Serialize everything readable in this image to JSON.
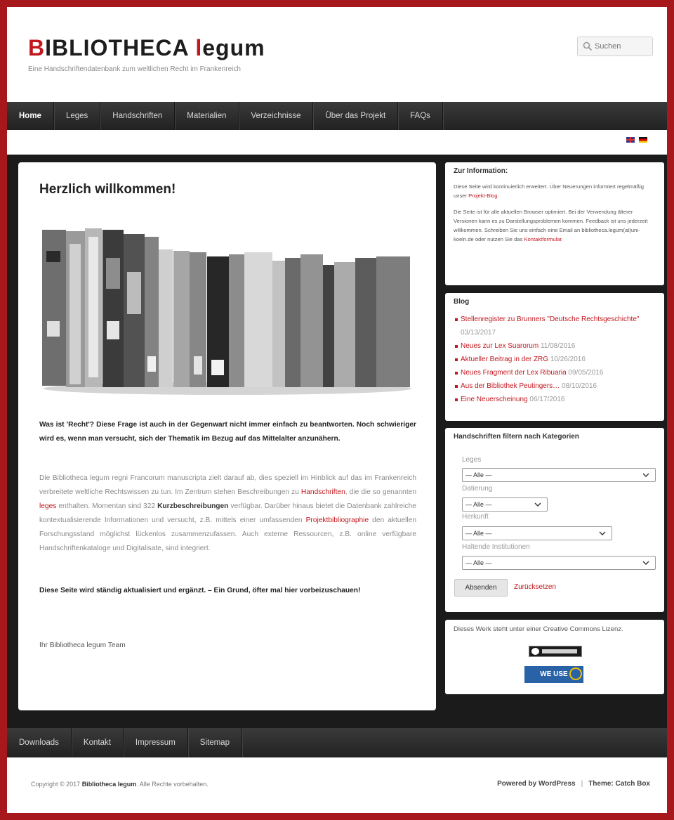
{
  "header": {
    "title_first_letter": "B",
    "title_rest": "IBLIOTHECA ",
    "title_accent_letter": "l",
    "title_end": "egum",
    "description": "Eine Handschriftendatenbank zum weltlichen Recht im Frankenreich",
    "search_placeholder": "Suchen"
  },
  "nav": {
    "items": [
      "Home",
      "Leges",
      "Handschriften",
      "Materialien",
      "Verzeichnisse",
      "Über das Projekt",
      "FAQs"
    ]
  },
  "main": {
    "title": "Herzlich willkommen!",
    "p1": "Was ist 'Recht'? Diese Frage ist auch in der Gegenwart nicht immer einfach zu beantworten. Noch schwieriger wird es, wenn man versucht, sich der Thematik im Bezug auf das Mittelalter anzunähern.",
    "p2_a": "Die Bibliotheca legum regni Francorum manuscripta zielt darauf ab, dies speziell im Hinblick auf das im Frankenreich verbreitete weltliche Rechtswissen zu tun. Im Zentrum stehen Beschreibungen zu ",
    "p2_link1": "Handschriften",
    "p2_b": ", die die so genannten ",
    "p2_link2": "leges",
    "p2_c": " enthalten. Momentan sind 322 ",
    "p2_strong": "Kurzbeschreibungen",
    "p2_d": " verfügbar. Darüber hinaus bietet die Datenbank zahlreiche kontextualisierende Informationen und versucht, z.B. mittels einer umfassenden ",
    "p2_link3": "Projektbibliographie",
    "p2_e": " den aktuellen Forschungsstand möglichst lückenlos zusammenzufassen. Auch externe Ressourcen, z.B. online verfügbare Handschriftenkataloge und Digitalisate, sind integriert.",
    "p3": "Diese Seite wird ständig aktualisiert und ergänzt. – Ein Grund, öfter mal hier vorbeizuschauen!",
    "p4": "Ihr Bibliotheca legum Team"
  },
  "sidebar": {
    "info": {
      "title": "Zur Information:",
      "text1_a": "Diese Seite wird kontinuierlich erweitert. Über Neuerungen informiert regelmäßig unser ",
      "text1_link": "Projekt-Blog",
      "text1_b": ".",
      "text2_a": "Die Seite ist für alle aktuellen Browser optimiert. Bei der Verwendung älterer Versionen kann es zu Darstellungsproblemen kommen. Feedback ist uns jederzeit willkommen. Schreiben Sie uns einfach eine Email an bibliotheca.legum(at)uni-koeln.de oder nutzen Sie das ",
      "text2_link": "Kontaktformular",
      "text2_b": "."
    },
    "blog": {
      "title": "Blog",
      "posts": [
        {
          "title": "Stellenregister zu Brunners \"Deutsche Rechtsgeschichte\"",
          "date": "03/13/2017"
        },
        {
          "title": "Neues zur Lex Suarorum",
          "date": "11/08/2016"
        },
        {
          "title": "Aktueller Beitrag in der ZRG",
          "date": "10/26/2016"
        },
        {
          "title": "Neues Fragment der Lex Ribuaria",
          "date": "09/05/2016"
        },
        {
          "title": "Aus der Bibliothek Peutingers…",
          "date": "08/10/2016"
        },
        {
          "title": "Eine Neuerscheinung",
          "date": "06/17/2016"
        }
      ]
    },
    "filter": {
      "title": "Handschriften filtern nach Kategorien",
      "label_leges": "Leges",
      "label_datierung": "Datierung",
      "label_herkunft": "Herkunft",
      "label_haltende": "Haltende Institutionen",
      "option_all": "— Alle —",
      "submit": "Absenden",
      "reset": "Zurücksetzen"
    },
    "license": {
      "text": "Dieses Werk steht unter einer Creative Commons Lizenz.",
      "badge_text": "WE USE"
    }
  },
  "footer": {
    "nav": [
      "Downloads",
      "Kontakt",
      "Impressum",
      "Sitemap"
    ],
    "copyright_a": "Copyright © 2017 ",
    "copyright_b": "Bibliotheca legum",
    "copyright_c": ". Alle Rechte vorbehalten.",
    "powered": "Powered by WordPress",
    "theme": "Theme: Catch Box"
  },
  "colors": {
    "accent": "#c1181f",
    "nav_bg": "#2b2b2b",
    "page_bg": "#1b1b1b",
    "frame": "#a6181c"
  }
}
